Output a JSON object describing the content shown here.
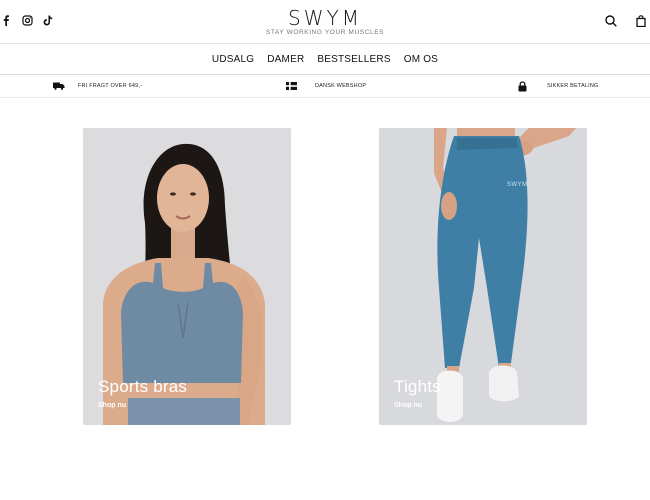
{
  "header": {
    "logo": "SWYM",
    "tagline": "STAY WORKING YOUR MUSCLES",
    "social_icons": [
      "facebook-icon",
      "instagram-icon",
      "tiktok-icon"
    ],
    "right_icons": [
      "search-icon",
      "shopping-bag-icon"
    ]
  },
  "nav": {
    "items": [
      {
        "label": "UDSALG"
      },
      {
        "label": "DAMER"
      },
      {
        "label": "BESTSELLERS"
      },
      {
        "label": "OM OS"
      }
    ]
  },
  "usp": [
    {
      "icon": "truck-icon",
      "text": "FRI FRAGT OVER 649,-"
    },
    {
      "icon": "danish-flag-icon",
      "text": "DANSK WEBSHOP"
    },
    {
      "icon": "lock-icon",
      "text": "SIKKER BETALING"
    }
  ],
  "categories": [
    {
      "title": "Sports bras",
      "cta": "Shop nu",
      "product_color": "#6f8aa3"
    },
    {
      "title": "Tights",
      "cta": "Shop nu",
      "product_color": "#3f7fa6"
    }
  ]
}
